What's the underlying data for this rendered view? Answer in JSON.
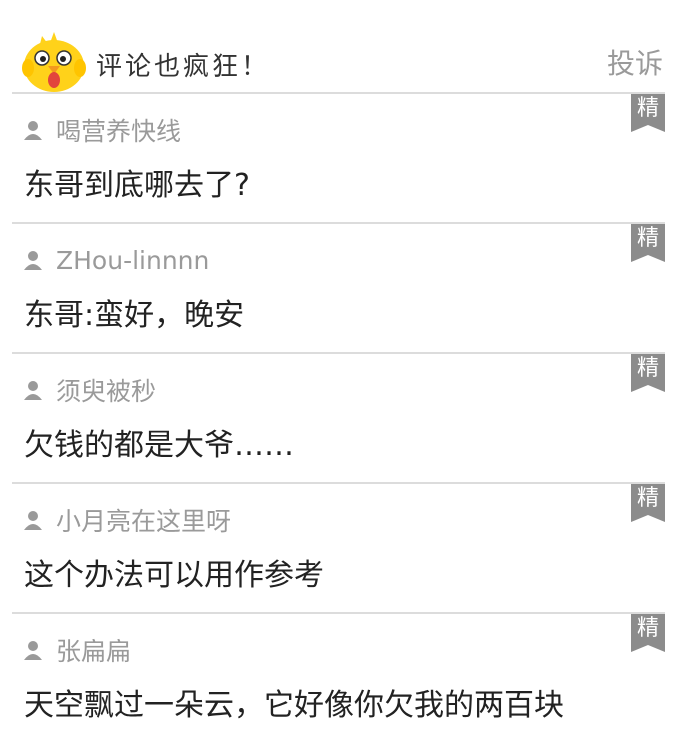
{
  "header": {
    "title": "评论也疯狂！",
    "report_label": "投诉"
  },
  "colors": {
    "badge": "#8c8c8c",
    "mascot": "#ffd21a",
    "divider": "#dcdcdc",
    "username": "#9a9a9a"
  },
  "comments": [
    {
      "user": "喝营养快线",
      "text": "东哥到底哪去了?",
      "badge": "精"
    },
    {
      "user": "ZHou-linnnn",
      "text": "东哥:蛮好，晚安",
      "badge": "精"
    },
    {
      "user": "须臾被秒",
      "text": "欠钱的都是大爷……",
      "badge": "精"
    },
    {
      "user": "小月亮在这里呀",
      "text": "这个办法可以用作参考",
      "badge": "精"
    },
    {
      "user": "张扁扁",
      "text": "天空飘过一朵云，它好像你欠我的两百块",
      "badge": "精"
    }
  ]
}
